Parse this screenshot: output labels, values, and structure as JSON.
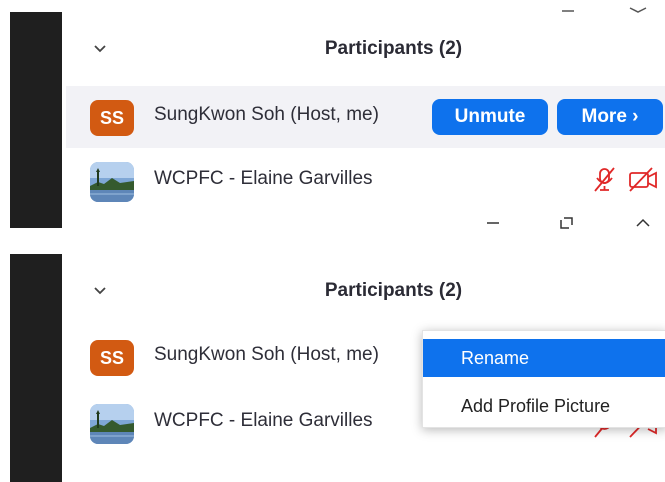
{
  "top_panel": {
    "title": "Participants (2)",
    "participants": [
      {
        "avatar_initials": "SS",
        "name": "SungKwon Soh (Host, me)"
      },
      {
        "name": "WCPFC - Elaine Garvilles"
      }
    ],
    "buttons": {
      "unmute": "Unmute",
      "more": "More ›"
    }
  },
  "bottom_panel": {
    "title": "Participants (2)",
    "participants": [
      {
        "avatar_initials": "SS",
        "name": "SungKwon Soh (Host, me)"
      },
      {
        "name": "WCPFC - Elaine Garvilles"
      }
    ],
    "context_menu": {
      "rename": "Rename",
      "add_profile_picture": "Add Profile Picture"
    }
  },
  "window_controls": {
    "minimize": "—",
    "restore": "⧉",
    "collapse": "^"
  },
  "colors": {
    "accent": "#0e72ed",
    "avatar": "#d25a12",
    "muted_red": "#e02828"
  },
  "icons": [
    "chevron-down-icon",
    "muted-mic-icon",
    "video-off-icon",
    "minimize-icon",
    "restore-icon",
    "collapse-icon"
  ]
}
